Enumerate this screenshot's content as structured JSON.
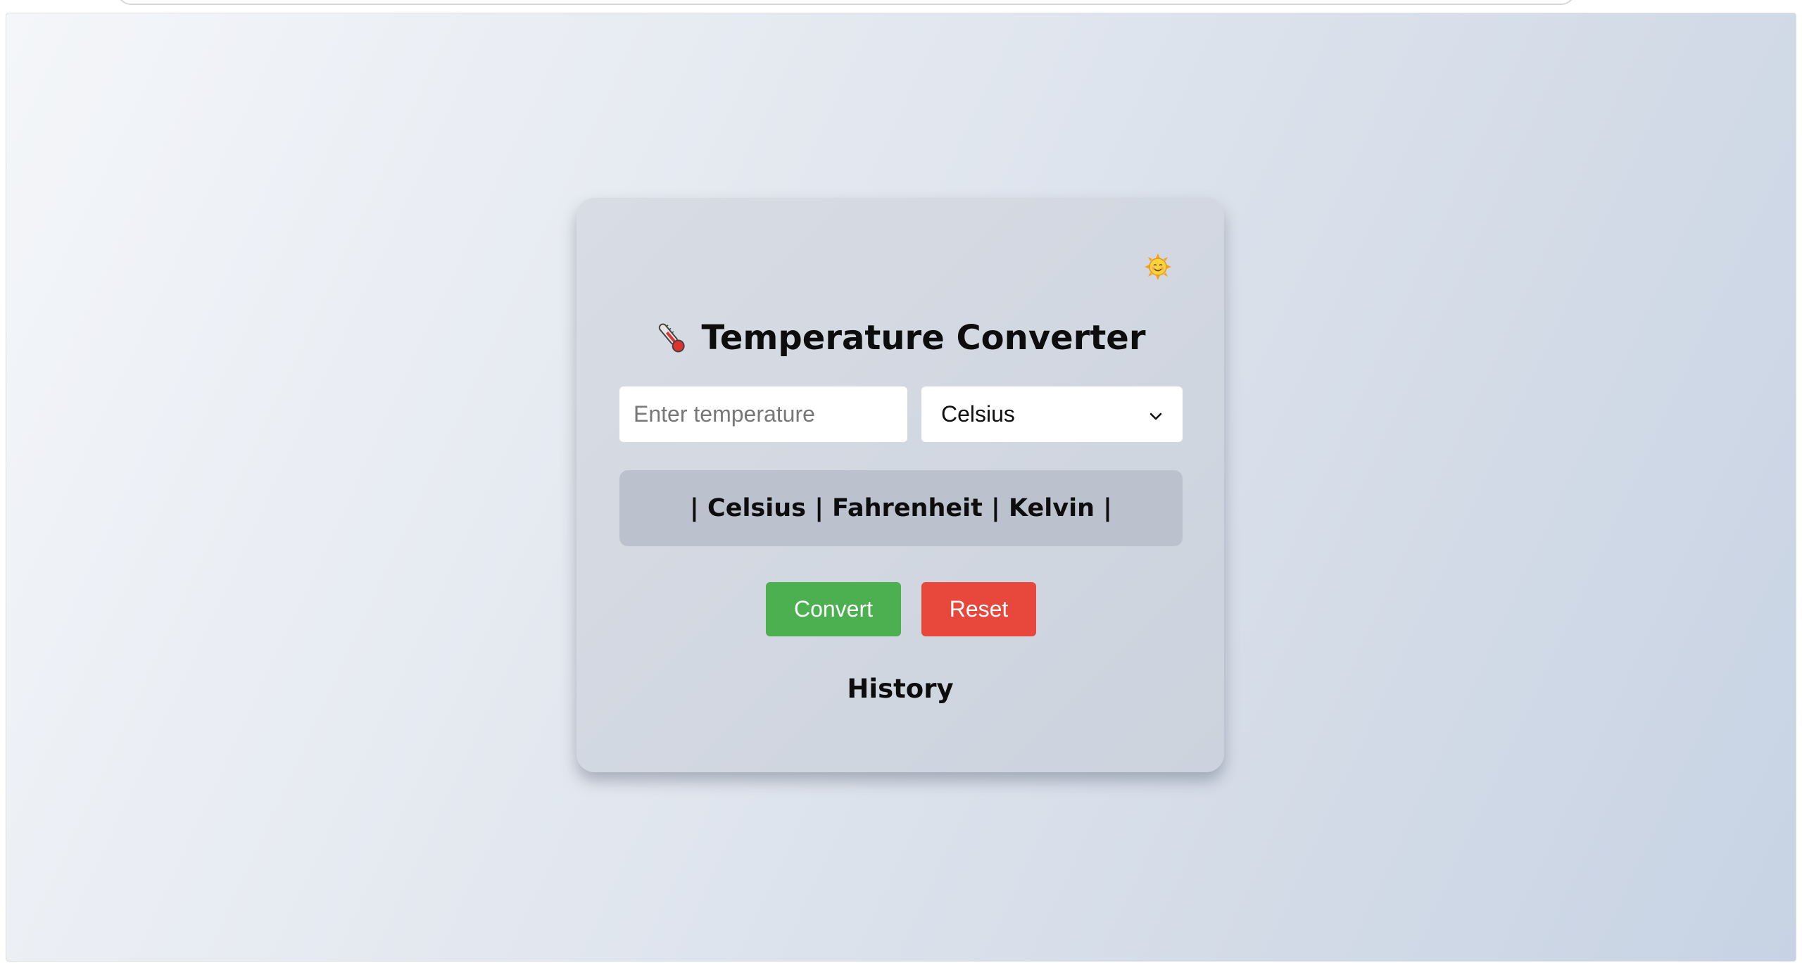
{
  "browser": {
    "address_bar_value": ""
  },
  "theme_toggle": {
    "icon": "sun-face-icon"
  },
  "converter": {
    "title": "Temperature Converter",
    "title_icon": "thermometer-icon",
    "input": {
      "value": "",
      "placeholder": "Enter temperature"
    },
    "unit_select": {
      "selected": "Celsius"
    },
    "result_text": "| Celsius | Fahrenheit | Kelvin |",
    "buttons": {
      "convert": "Convert",
      "reset": "Reset"
    },
    "history_title": "History"
  },
  "colors": {
    "convert_button": "#4caf50",
    "reset_button": "#e8483c",
    "result_background": "#bcc2cd"
  }
}
